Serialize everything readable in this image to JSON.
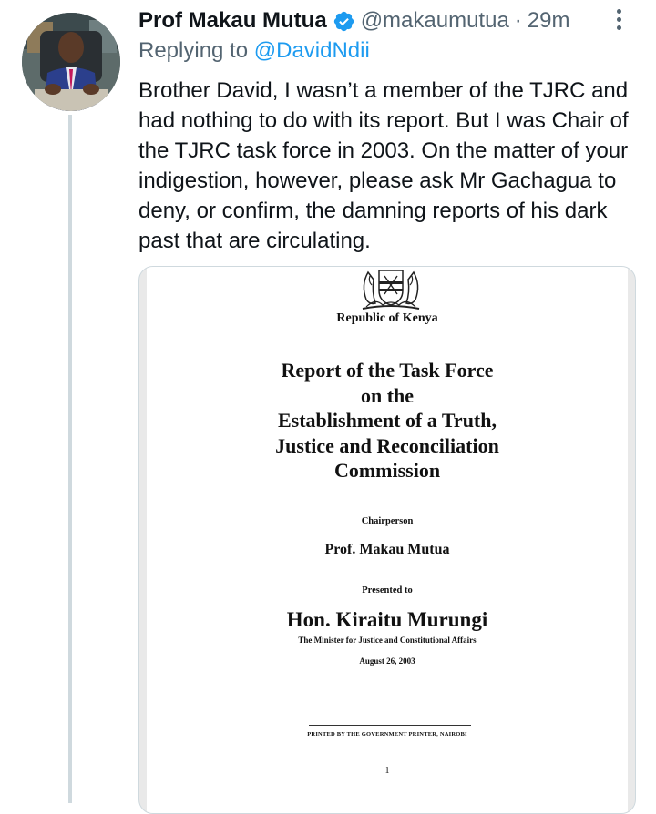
{
  "tweet": {
    "author_name": "Prof Makau Mutua",
    "handle": "@makaumutua",
    "separator": "·",
    "time": "29m",
    "replying_prefix": "Replying to",
    "replying_to": "@DavidNdii",
    "text": "Brother David, I wasn’t a member of the TJRC and had nothing to do with its report. But I was Chair of the TJRC task force in 2003.  On the matter of your indigestion, however, please ask Mr Gachagua to deny, or confirm, the damning reports of his dark past that are circulating.",
    "icons": {
      "verified": "verified-badge-icon",
      "more": "more-options-icon"
    },
    "colors": {
      "text": "#0f1419",
      "secondary": "#536471",
      "link": "#1d9bf0",
      "verified": "#1d9bf0",
      "thread_line": "#cfd9de"
    }
  },
  "document": {
    "republic": "Republic of Kenya",
    "title_lines": [
      "Report of the Task Force",
      "on the",
      "Establishment of a Truth,",
      "Justice and Reconciliation",
      "Commission"
    ],
    "chair_label": "Chairperson",
    "chair_name": "Prof. Makau Mutua",
    "presented_label": "Presented to",
    "minister_name": "Hon. Kiraitu Murungi",
    "minister_title": "The Minister for Justice and Constitutional Affairs",
    "date": "August 26, 2003",
    "printer": "PRINTED BY THE GOVERNMENT PRINTER, NAIROBI",
    "page_number": "1"
  }
}
